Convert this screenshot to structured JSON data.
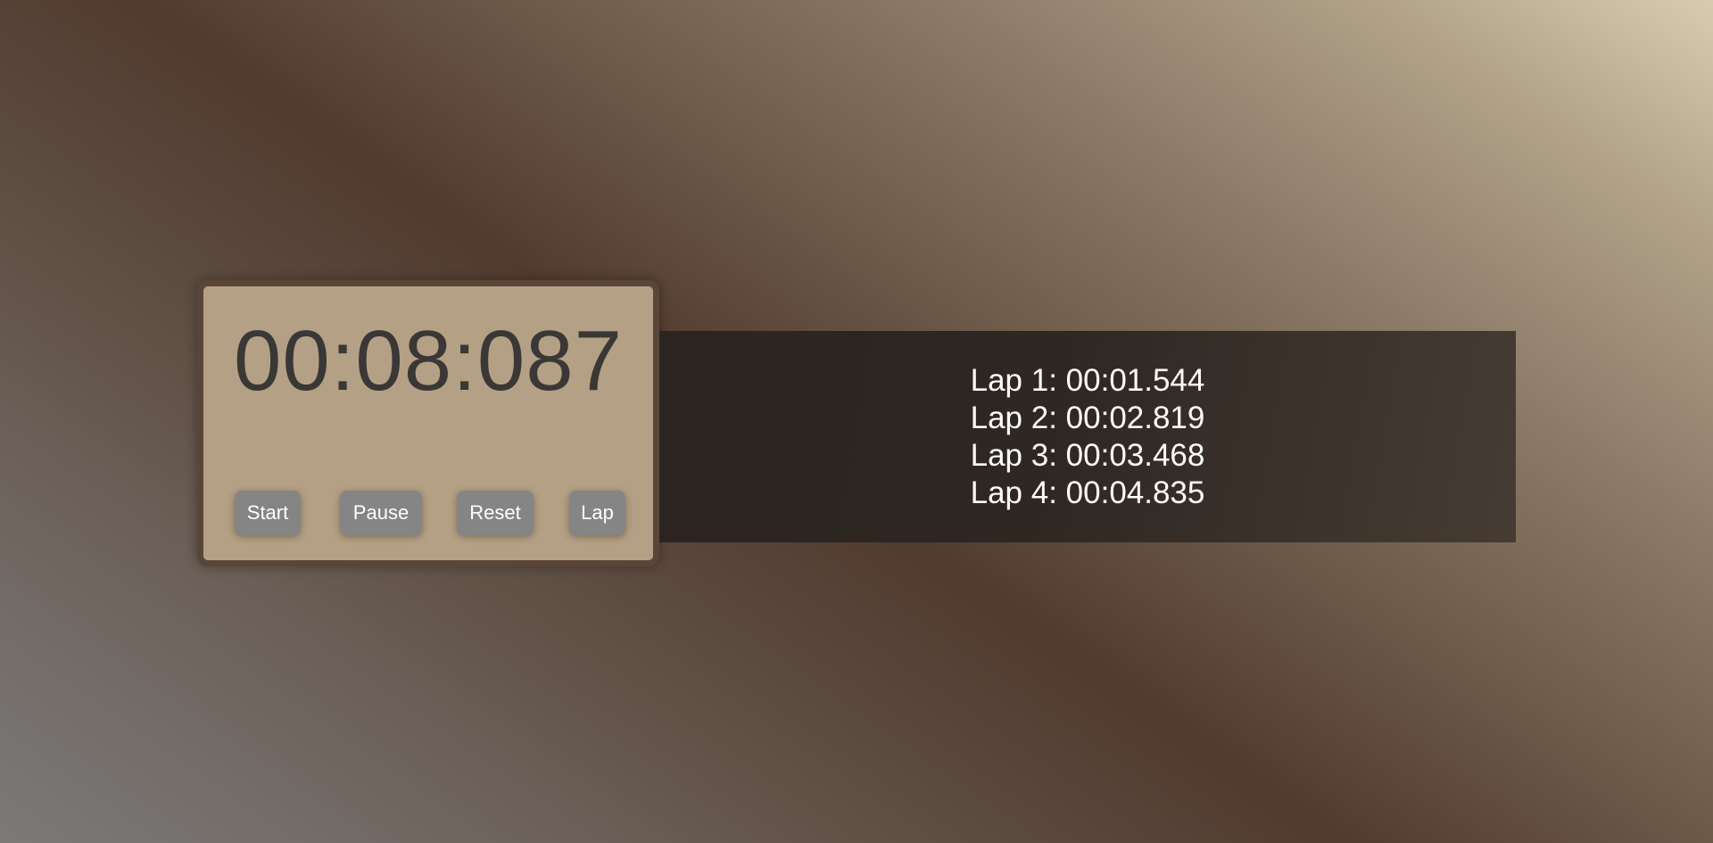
{
  "stopwatch": {
    "display": "00:08:087",
    "buttons": {
      "start": "Start",
      "pause": "Pause",
      "reset": "Reset",
      "lap": "Lap"
    }
  },
  "laps": [
    "Lap 1: 00:01.544",
    "Lap 2: 00:02.819",
    "Lap 3: 00:03.468",
    "Lap 4: 00:04.835"
  ],
  "colors": {
    "card": "#b4a084",
    "card_border": "#5a4638",
    "display_text": "#3a3836",
    "button": "#858585",
    "button_text": "#ffffff",
    "laps_panel": "#2b2420",
    "lap_text": "#ffffff"
  }
}
